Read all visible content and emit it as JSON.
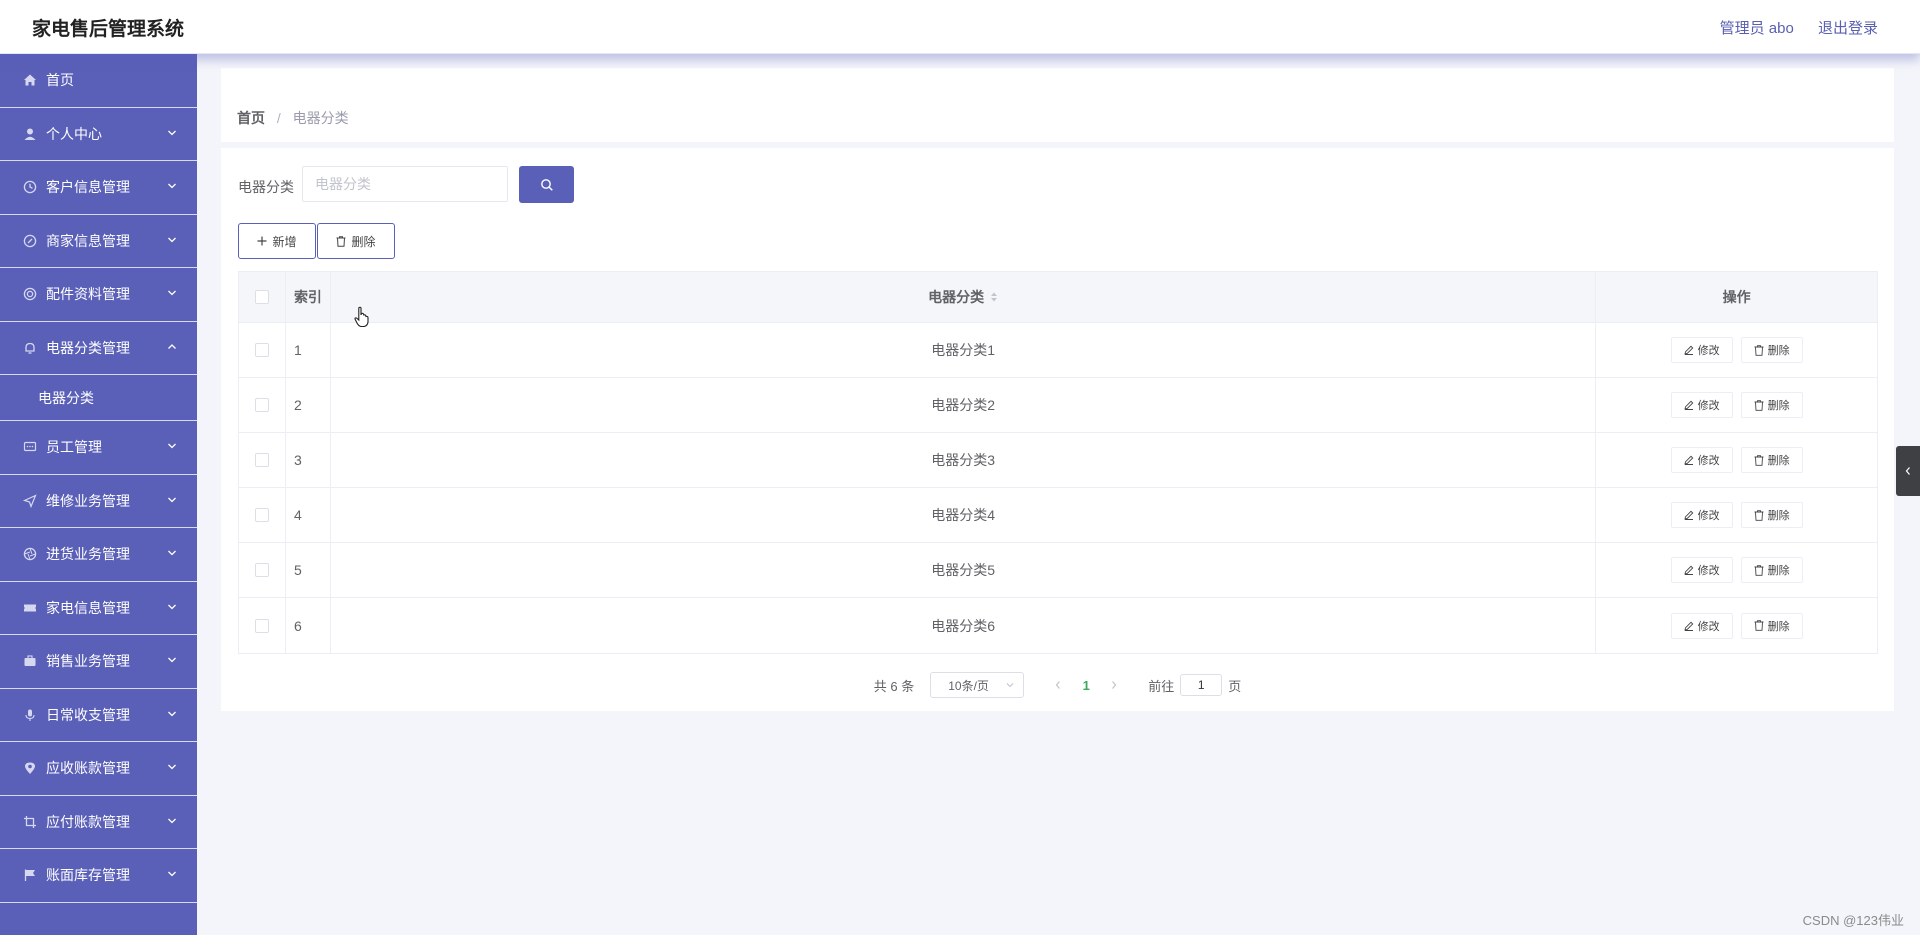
{
  "app": {
    "title": "家电售后管理系统",
    "user_label": "管理员 abo",
    "logout": "退出登录"
  },
  "sidebar": {
    "items": [
      {
        "label": "首页",
        "icon": "home-icon"
      },
      {
        "label": "个人中心",
        "icon": "user-icon"
      },
      {
        "label": "客户信息管理",
        "icon": "clock-icon"
      },
      {
        "label": "商家信息管理",
        "icon": "compass-icon"
      },
      {
        "label": "配件资料管理",
        "icon": "circle-icon"
      },
      {
        "label": "电器分类管理",
        "icon": "bell-icon",
        "expanded": true
      },
      {
        "label": "员工管理",
        "icon": "chat-icon"
      },
      {
        "label": "维修业务管理",
        "icon": "send-icon"
      },
      {
        "label": "进货业务管理",
        "icon": "aperture-icon"
      },
      {
        "label": "家电信息管理",
        "icon": "ticket-icon"
      },
      {
        "label": "销售业务管理",
        "icon": "briefcase-icon"
      },
      {
        "label": "日常收支管理",
        "icon": "mic-icon"
      },
      {
        "label": "应收账款管理",
        "icon": "location-icon"
      },
      {
        "label": "应付账款管理",
        "icon": "crop-icon"
      },
      {
        "label": "账面库存管理",
        "icon": "flag-icon"
      }
    ],
    "submenu": {
      "label": "电器分类"
    }
  },
  "breadcrumb": {
    "home": "首页",
    "separator": "/",
    "current": "电器分类"
  },
  "search": {
    "label": "电器分类",
    "placeholder": "电器分类",
    "value": ""
  },
  "actions": {
    "add_label": "新增",
    "delete_label": "删除"
  },
  "table": {
    "headers": {
      "index": "索引",
      "category": "电器分类",
      "operation": "操作"
    },
    "rows": [
      {
        "index": "1",
        "category": "电器分类1"
      },
      {
        "index": "2",
        "category": "电器分类2"
      },
      {
        "index": "3",
        "category": "电器分类3"
      },
      {
        "index": "4",
        "category": "电器分类4"
      },
      {
        "index": "5",
        "category": "电器分类5"
      },
      {
        "index": "6",
        "category": "电器分类6"
      }
    ],
    "edit_label": "修改",
    "delete_label": "删除"
  },
  "pagination": {
    "total": "共 6 条",
    "page_size": "10条/页",
    "current_page": "1",
    "goto_label": "前往",
    "goto_value": "1",
    "page_unit": "页"
  },
  "watermark": "CSDN @123伟业",
  "colors": {
    "primary": "#5a5fb7",
    "active_page": "#3caa5c"
  }
}
